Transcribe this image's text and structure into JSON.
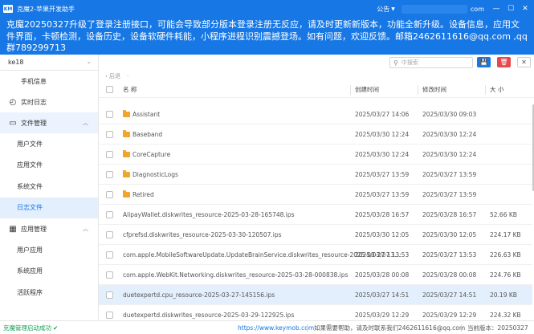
{
  "window": {
    "logo": "KM",
    "title": "克魔2-苹果开发助手",
    "notice": "公告",
    "email_suffix": "com",
    "minimize": "—",
    "maximize": "☐",
    "close": "✕"
  },
  "banner": {
    "text": "克魔20250327升级了登录注册接口，可能会导致部分版本登录注册无反应，请及时更新新版本，功能全新升级。设备信息，应用文件界面，卡顿检测，设备历史，设备软硬件耗能，小程序进程识别震撼登场。如有问题，欢迎反馈。邮箱2462611616@qq.com ,qq群789299713"
  },
  "sidebar": {
    "device": "ke18",
    "items": [
      {
        "icon": "apple-icon",
        "label": "手机信息"
      },
      {
        "icon": "log-icon",
        "label": "实时日志"
      },
      {
        "icon": "folder-icon",
        "label": "文件管理",
        "open": true,
        "children": [
          "用户文件",
          "应用文件",
          "系统文件",
          "日志文件"
        ]
      },
      {
        "icon": "apps-icon",
        "label": "应用管理",
        "open": true,
        "children": [
          "用户应用",
          "系统应用",
          "活跃程序"
        ]
      }
    ]
  },
  "toolbar": {
    "search_placeholder": "中搜索",
    "save_label": "💾",
    "delete_label": "🗑",
    "close_label": "✕"
  },
  "breadcrumb": {
    "back": "‹ 后退",
    "sep": "·"
  },
  "table": {
    "headers": {
      "name": "名 称",
      "ctime": "创建时间",
      "mtime": "修改时间",
      "size": "大 小"
    },
    "rows": [
      {
        "name": "Assistant",
        "folder": true,
        "ctime": "2025/03/27 14:06",
        "mtime": "2025/03/30 09:03",
        "size": ""
      },
      {
        "name": "Baseband",
        "folder": true,
        "ctime": "2025/03/30 12:24",
        "mtime": "2025/03/30 12:24",
        "size": ""
      },
      {
        "name": "CoreCapture",
        "folder": true,
        "ctime": "2025/03/30 12:24",
        "mtime": "2025/03/30 12:24",
        "size": ""
      },
      {
        "name": "DiagnosticLogs",
        "folder": true,
        "ctime": "2025/03/27 13:59",
        "mtime": "2025/03/27 13:59",
        "size": ""
      },
      {
        "name": "Retired",
        "folder": true,
        "ctime": "2025/03/27 13:59",
        "mtime": "2025/03/27 13:59",
        "size": ""
      },
      {
        "name": "AlipayWallet.diskwrites_resource-2025-03-28-165748.ips",
        "folder": false,
        "ctime": "2025/03/28 16:57",
        "mtime": "2025/03/28 16:57",
        "size": "52.66 KB"
      },
      {
        "name": "cfprefsd.diskwrites_resource-2025-03-30-120507.ips",
        "folder": false,
        "ctime": "2025/03/30 12:05",
        "mtime": "2025/03/30 12:05",
        "size": "224.17 KB"
      },
      {
        "name": "com.apple.MobileSoftwareUpdate.UpdateBrainService.diskwrites_resource-2025-03-27-13...",
        "folder": false,
        "ctime": "2025/03/27 13:53",
        "mtime": "2025/03/27 13:53",
        "size": "226.63 KB"
      },
      {
        "name": "com.apple.WebKit.Networking.diskwrites_resource-2025-03-28-000838.ips",
        "folder": false,
        "ctime": "2025/03/28 00:08",
        "mtime": "2025/03/28 00:08",
        "size": "224.76 KB"
      },
      {
        "name": "duetexpertd.cpu_resource-2025-03-27-145156.ips",
        "folder": false,
        "ctime": "2025/03/27 14:51",
        "mtime": "2025/03/27 14:51",
        "size": "20.19 KB",
        "selected": true
      },
      {
        "name": "duetexpertd.diskwrites_resource-2025-03-29-122925.ips",
        "folder": false,
        "ctime": "2025/03/29 12:29",
        "mtime": "2025/03/29 12:29",
        "size": "224.32 KB"
      }
    ]
  },
  "status": {
    "left": "克魔管理启动成功",
    "check": "✔",
    "link": "https://www.keymob.com",
    "help": "如果需要帮助，请及时联系我们2462611616@qq.com",
    "version_label": "当前版本：",
    "version": "20250327"
  }
}
